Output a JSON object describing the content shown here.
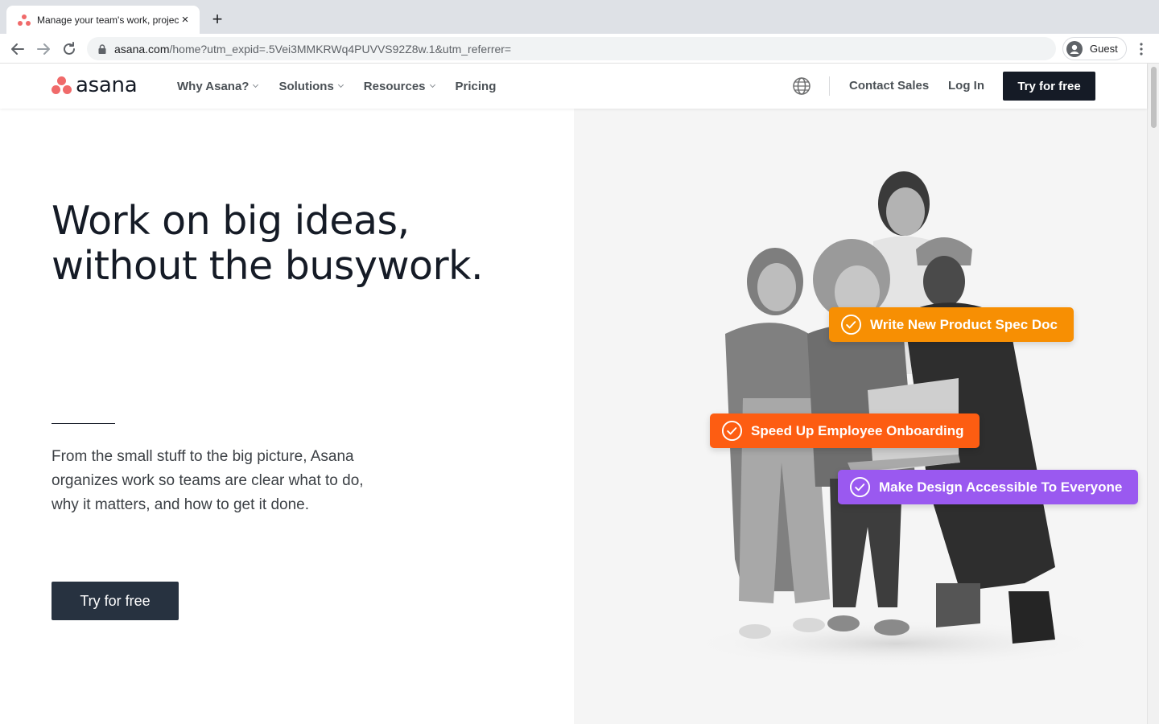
{
  "browser": {
    "tab_title": "Manage your team's work, projects, & tasks online • Asana",
    "tab_close": "×",
    "new_tab": "+",
    "url_host": "asana.com",
    "url_path": "/home?utm_expid=.5Vei3MMKRWq4PUVVS92Z8w.1&utm_referrer=",
    "profile_label": "Guest"
  },
  "header": {
    "logo_text": "asana",
    "nav": [
      {
        "label": "Why Asana?",
        "has_dropdown": true
      },
      {
        "label": "Solutions",
        "has_dropdown": true
      },
      {
        "label": "Resources",
        "has_dropdown": true
      },
      {
        "label": "Pricing",
        "has_dropdown": false
      }
    ],
    "contact_sales": "Contact Sales",
    "log_in": "Log In",
    "cta": "Try for free"
  },
  "hero": {
    "title_line1": "Work on big ideas,",
    "title_line2": "without the busywork.",
    "subtitle": "From the small stuff to the big picture, Asana organizes work so teams are clear what to do, why it matters, and how to get it done.",
    "cta": "Try for free"
  },
  "tasks": [
    {
      "label": "Write New Product Spec Doc",
      "color": "#f78f03"
    },
    {
      "label": "Speed Up Employee Onboarding",
      "color": "#fd5d12"
    },
    {
      "label": "Make Design Accessible To Everyone",
      "color": "#9a59f0"
    }
  ],
  "colors": {
    "brand_coral": "#f06a6a",
    "dark_navy": "#151b26",
    "hero_button": "#273240"
  }
}
